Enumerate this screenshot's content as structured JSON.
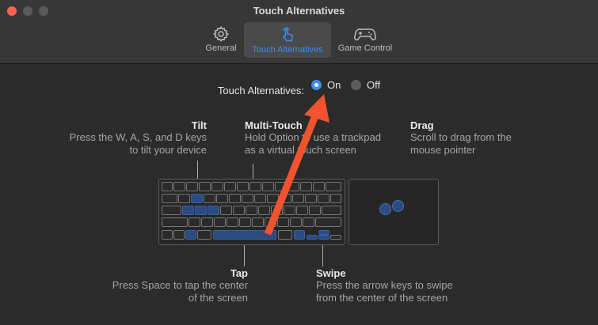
{
  "window": {
    "title": "Touch Alternatives",
    "controls": {
      "close_color": "#ff5f57",
      "minimize_color": "#5a5a5a",
      "zoom_color": "#5a5a5a"
    }
  },
  "tabs": [
    {
      "label": "General",
      "icon": "gear-icon",
      "selected": false
    },
    {
      "label": "Touch Alternatives",
      "icon": "hand-tap-icon",
      "selected": true
    },
    {
      "label": "Game Control",
      "icon": "gamepad-icon",
      "selected": false
    }
  ],
  "setting": {
    "label": "Touch Alternatives:",
    "options": [
      {
        "label": "On",
        "selected": true
      },
      {
        "label": "Off",
        "selected": false
      }
    ]
  },
  "sections": {
    "tilt": {
      "title": "Tilt",
      "line1": "Press the W, A, S, and D keys",
      "line2": "to tilt your device"
    },
    "multitouch": {
      "title": "Multi-Touch",
      "line1": "Hold Option to use a trackpad",
      "line2": "as a virtual touch screen"
    },
    "drag": {
      "title": "Drag",
      "line1": "Scroll to drag from the",
      "line2": "mouse pointer"
    },
    "tap": {
      "title": "Tap",
      "line1": "Press Space to tap the center",
      "line2": "of the screen"
    },
    "swipe": {
      "title": "Swipe",
      "line1": "Press the arrow keys to swipe",
      "line2": "from the center of the screen"
    }
  },
  "colors": {
    "accent": "#3a8ef5",
    "highlight_key": "#2c4a84",
    "arrow": "#f0532d"
  }
}
